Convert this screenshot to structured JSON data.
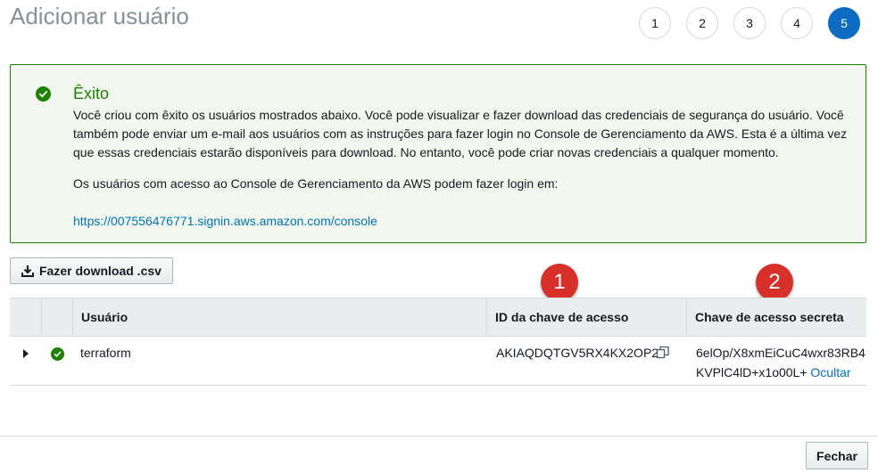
{
  "page": {
    "title": "Adicionar usuário"
  },
  "steps": [
    {
      "label": "1",
      "active": false
    },
    {
      "label": "2",
      "active": false
    },
    {
      "label": "3",
      "active": false
    },
    {
      "label": "4",
      "active": false
    },
    {
      "label": "5",
      "active": true
    }
  ],
  "alert": {
    "icon": "success-check-icon",
    "title": "Êxito",
    "body": "Você criou com êxito os usuários mostrados abaixo. Você pode visualizar e fazer download das credenciais de segurança do usuário. Você também pode enviar um e-mail aos usuários com as instruções para fazer login no Console de Gerenciamento da AWS. Esta é a última vez que essas credenciais estarão disponíveis para download. No entanto, você pode criar novas credenciais a qualquer momento.",
    "login_text": "Os usuários com acesso ao Console de Gerenciamento da AWS podem fazer login em:",
    "login_url": "https://007556476771.signin.aws.amazon.com/console"
  },
  "download_button": {
    "label": "Fazer download .csv",
    "icon": "download-icon"
  },
  "markers": {
    "one": "1",
    "two": "2"
  },
  "table": {
    "headers": {
      "user": "Usuário",
      "access_key_id": "ID da chave de acesso",
      "secret_key": "Chave de acesso secreta"
    },
    "rows": [
      {
        "user": "terraform",
        "access_key_id": "AKIAQDQTGV5RX4KX2OP2",
        "secret_key": "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",
        "hide_label": "Ocultar"
      }
    ]
  },
  "footer": {
    "close_label": "Fechar"
  },
  "colors": {
    "accent": "#0e6bc2",
    "success": "#1d8102",
    "marker": "#d7302a",
    "link": "#0073bb"
  }
}
